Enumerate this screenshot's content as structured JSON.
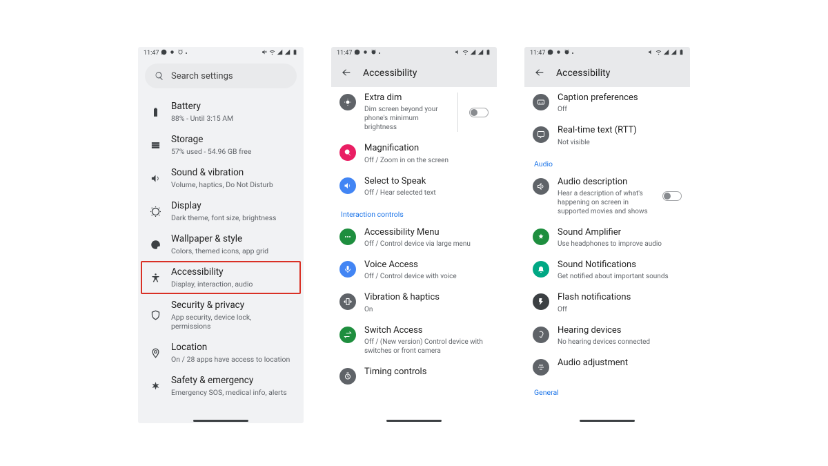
{
  "status": {
    "time": "11:47"
  },
  "screen1": {
    "search_placeholder": "Search settings",
    "items": [
      {
        "title": "Battery",
        "sub": "88% - Until 3:15 AM"
      },
      {
        "title": "Storage",
        "sub": "57% used - 54.96 GB free"
      },
      {
        "title": "Sound & vibration",
        "sub": "Volume, haptics, Do Not Disturb"
      },
      {
        "title": "Display",
        "sub": "Dark theme, font size, brightness"
      },
      {
        "title": "Wallpaper & style",
        "sub": "Colors, themed icons, app grid"
      },
      {
        "title": "Accessibility",
        "sub": "Display, interaction, audio"
      },
      {
        "title": "Security & privacy",
        "sub": "App security, device lock, permissions"
      },
      {
        "title": "Location",
        "sub": "On / 28 apps have access to location"
      },
      {
        "title": "Safety & emergency",
        "sub": "Emergency SOS, medical info, alerts"
      }
    ]
  },
  "screen2": {
    "header": "Accessibility",
    "items": [
      {
        "title": "Extra dim",
        "sub": "Dim screen beyond your phone's minimum brightness"
      },
      {
        "title": "Magnification",
        "sub": "Off / Zoom in on the screen"
      },
      {
        "title": "Select to Speak",
        "sub": "Off / Hear selected text"
      }
    ],
    "section_interaction": "Interaction controls",
    "items2": [
      {
        "title": "Accessibility Menu",
        "sub": "Off / Control device via large menu"
      },
      {
        "title": "Voice Access",
        "sub": "Off / Control device with voice"
      },
      {
        "title": "Vibration & haptics",
        "sub": "On"
      },
      {
        "title": "Switch Access",
        "sub": "Off / (New version) Control device with switches or front camera"
      },
      {
        "title": "Timing controls",
        "sub": ""
      }
    ]
  },
  "screen3": {
    "header": "Accessibility",
    "items": [
      {
        "title": "Caption preferences",
        "sub": "Off"
      },
      {
        "title": "Real-time text (RTT)",
        "sub": "Not visible"
      }
    ],
    "section_audio": "Audio",
    "items2": [
      {
        "title": "Audio description",
        "sub": "Hear a description of what's happening on screen in supported movies and shows"
      },
      {
        "title": "Sound Amplifier",
        "sub": "Use headphones to improve audio"
      },
      {
        "title": "Sound Notifications",
        "sub": "Get notified about important sounds"
      },
      {
        "title": "Flash notifications",
        "sub": "Off"
      },
      {
        "title": "Hearing devices",
        "sub": "No hearing devices connected"
      },
      {
        "title": "Audio adjustment",
        "sub": ""
      }
    ],
    "section_general": "General"
  }
}
